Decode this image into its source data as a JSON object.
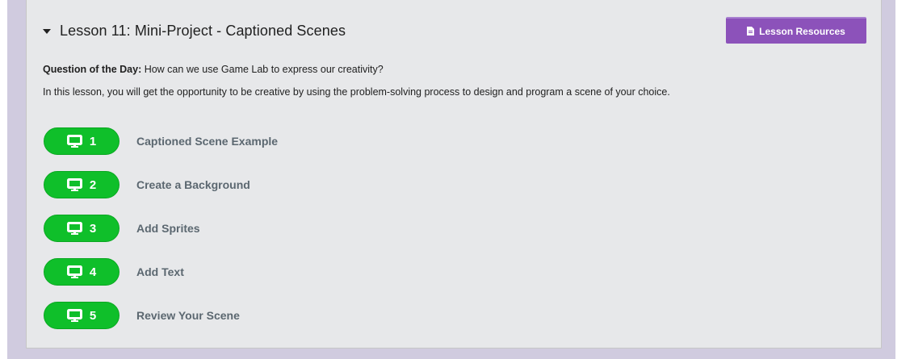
{
  "lesson": {
    "title": "Lesson 11: Mini-Project - Captioned Scenes",
    "resources_button_label": "Lesson Resources",
    "question_label": "Question of the Day:",
    "question_text": " How can we use Game Lab to express our creativity?",
    "description": "In this lesson, you will get the opportunity to be creative by using the problem-solving process to design and program a scene of your choice."
  },
  "levels": [
    {
      "number": "1",
      "name": "Captioned Scene Example",
      "icon": "computer-icon"
    },
    {
      "number": "2",
      "name": "Create a Background",
      "icon": "computer-icon"
    },
    {
      "number": "3",
      "name": "Add Sprites",
      "icon": "computer-icon"
    },
    {
      "number": "4",
      "name": "Add Text",
      "icon": "computer-icon"
    },
    {
      "number": "5",
      "name": "Review Your Scene",
      "icon": "computer-icon"
    }
  ],
  "colors": {
    "background_band": "#d0cbdf",
    "card_background": "#e7e8ea",
    "resources_button": "#8c52ba",
    "level_bubble": "#0fbf2a",
    "level_name_text": "#5b6770"
  }
}
